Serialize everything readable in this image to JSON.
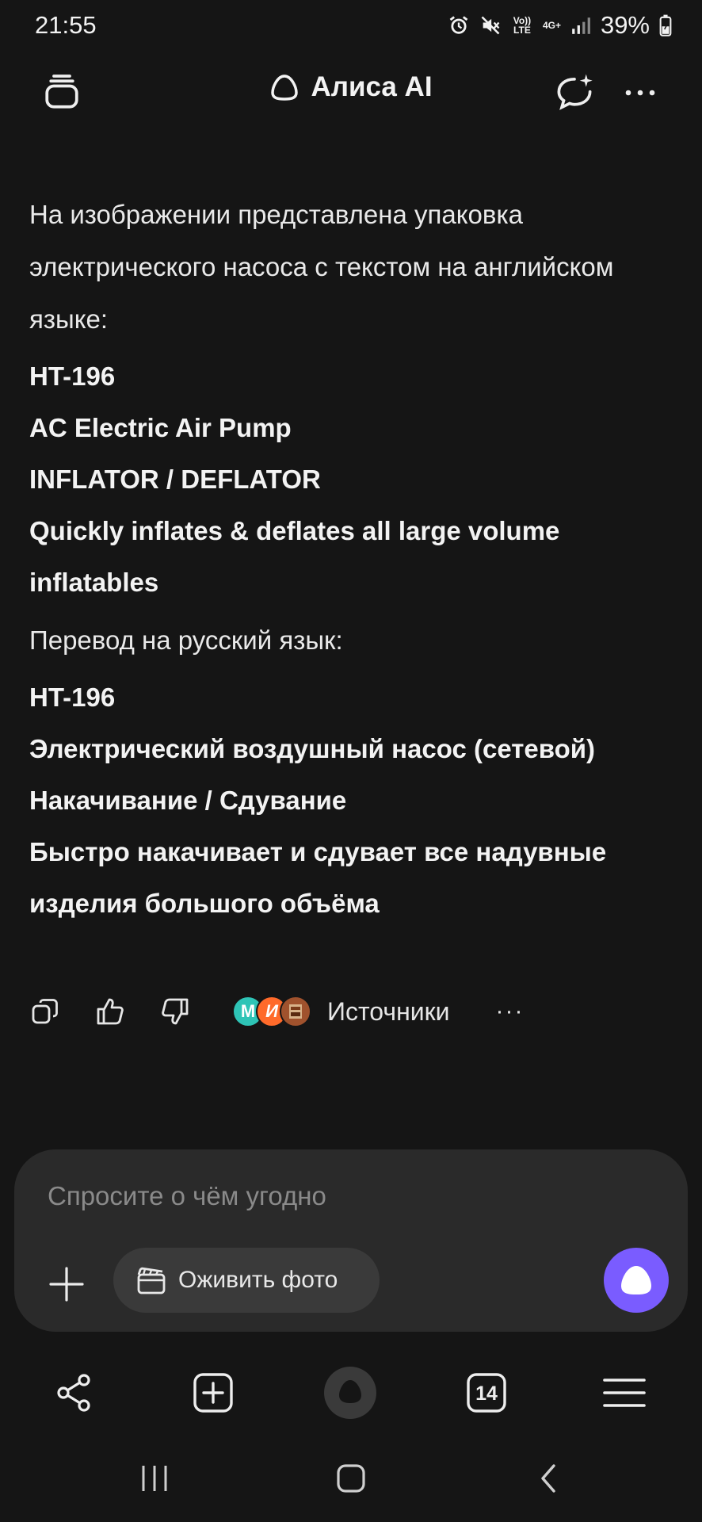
{
  "status_bar": {
    "time": "21:55",
    "volte": "Vo)) LTE",
    "net": "4G+",
    "battery": "39%"
  },
  "header": {
    "title": "Алиса AI",
    "icons": [
      "history-icon",
      "alice-logo-icon",
      "new-chat-icon",
      "more-icon"
    ]
  },
  "message": {
    "intro": "На изображении представлена упаковка электрического насоса с текстом на английском языке:",
    "english_lines": [
      "HT-196",
      "AC Electric Air Pump",
      "INFLATOR / DEFLATOR",
      "Quickly inflates & deflates all large volume inflatables"
    ],
    "translation_heading": "Перевод на русский язык:",
    "russian_lines": [
      "HT-196",
      "Электрический воздушный насос (сетевой)",
      "Накачивание / Сдувание",
      "Быстро накачивает и сдувает все надувные изделия большого объёма"
    ]
  },
  "actions": {
    "sources_label": "Источники",
    "avatars": [
      "М",
      "И",
      ""
    ],
    "more": "···",
    "colors": {
      "avatar1": "#2ec4b6",
      "avatar2": "#ff6a2a",
      "avatar3": "#a0522d"
    }
  },
  "input": {
    "placeholder": "Спросите о чём угодно",
    "chip_label": "Оживить фото",
    "accent": "#7a5cff"
  },
  "bottom_nav": {
    "tabs_count": "14",
    "icons": [
      "share-icon",
      "new-tab-icon",
      "alice-home-icon",
      "tabs-icon",
      "menu-icon"
    ]
  }
}
